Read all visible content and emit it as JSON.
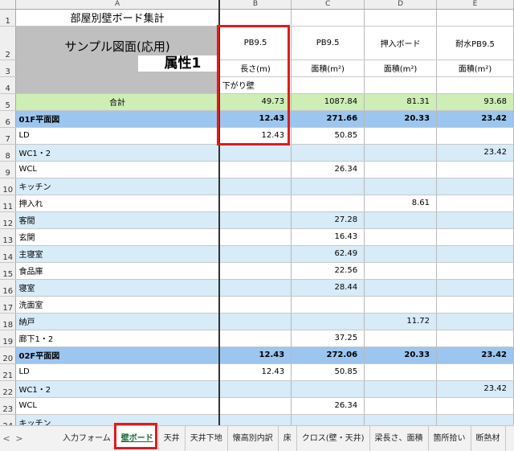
{
  "sheet": {
    "title": "部屋別壁ボード集計",
    "sample_label": "サンプル図面(応用)",
    "attr_label": "属性1",
    "col_letters": [
      "A",
      "B",
      "C",
      "D",
      "E"
    ],
    "row_numbers": [
      "1",
      "2",
      "3",
      "4",
      "5",
      "6",
      "7",
      "8",
      "9",
      "10",
      "11",
      "12",
      "13",
      "14",
      "15",
      "16",
      "17",
      "18",
      "19",
      "20",
      "21",
      "22",
      "23",
      "24"
    ],
    "headers": {
      "row2": [
        "PB9.5",
        "PB9.5",
        "押入ボード",
        "耐水PB9.5"
      ],
      "row3": [
        "長さ(m)",
        "面積(m²)",
        "面積(m²)",
        "面積(m²)"
      ],
      "row4": [
        "下がり壁",
        "",
        "",
        ""
      ]
    },
    "rows": [
      {
        "label": "合計",
        "style": "total",
        "vals": [
          "49.73",
          "1087.84",
          "81.31",
          "93.68"
        ]
      },
      {
        "label": "01F平面図",
        "style": "floor",
        "vals": [
          "12.43",
          "271.66",
          "20.33",
          "23.42"
        ]
      },
      {
        "label": "LD",
        "style": "white",
        "vals": [
          "12.43",
          "50.85",
          "",
          ""
        ]
      },
      {
        "label": "WC1・2",
        "style": "blue",
        "vals": [
          "",
          "",
          "",
          "23.42"
        ]
      },
      {
        "label": "WCL",
        "style": "white",
        "vals": [
          "",
          "26.34",
          "",
          ""
        ]
      },
      {
        "label": "キッチン",
        "style": "blue",
        "vals": [
          "",
          "",
          "",
          ""
        ]
      },
      {
        "label": "押入れ",
        "style": "white",
        "vals": [
          "",
          "",
          "8.61",
          ""
        ]
      },
      {
        "label": "客間",
        "style": "blue",
        "vals": [
          "",
          "27.28",
          "",
          ""
        ]
      },
      {
        "label": "玄関",
        "style": "white",
        "vals": [
          "",
          "16.43",
          "",
          ""
        ]
      },
      {
        "label": "主寝室",
        "style": "blue",
        "vals": [
          "",
          "62.49",
          "",
          ""
        ]
      },
      {
        "label": "食品庫",
        "style": "white",
        "vals": [
          "",
          "22.56",
          "",
          ""
        ]
      },
      {
        "label": "寝室",
        "style": "blue",
        "vals": [
          "",
          "28.44",
          "",
          ""
        ]
      },
      {
        "label": "洗面室",
        "style": "white",
        "vals": [
          "",
          "",
          "",
          ""
        ]
      },
      {
        "label": "納戸",
        "style": "blue",
        "vals": [
          "",
          "",
          "11.72",
          ""
        ]
      },
      {
        "label": "廊下1・2",
        "style": "white",
        "vals": [
          "",
          "37.25",
          "",
          ""
        ]
      },
      {
        "label": "02F平面図",
        "style": "floor",
        "vals": [
          "12.43",
          "272.06",
          "20.33",
          "23.42"
        ]
      },
      {
        "label": "LD",
        "style": "white",
        "vals": [
          "12.43",
          "50.85",
          "",
          ""
        ]
      },
      {
        "label": "WC1・2",
        "style": "blue",
        "vals": [
          "",
          "",
          "",
          "23.42"
        ]
      },
      {
        "label": "WCL",
        "style": "white",
        "vals": [
          "",
          "26.34",
          "",
          ""
        ]
      },
      {
        "label": "キッチン",
        "style": "blue",
        "vals": [
          "",
          "",
          "",
          ""
        ]
      }
    ]
  },
  "tabs": {
    "nav_prev": "<",
    "nav_next": ">",
    "items": [
      "入力フォーム",
      "壁ボード",
      "天井",
      "天井下地",
      "懐高別内訳",
      "床",
      "クロス(壁・天井)",
      "梁長さ、面積",
      "箇所拾い",
      "断熱材"
    ],
    "active_index": 1
  },
  "colors": {
    "highlight": "#e01b1b",
    "total_row": "#cdeeb4",
    "floor_row": "#9cc6ef",
    "alt_row": "#d7ebf8"
  }
}
